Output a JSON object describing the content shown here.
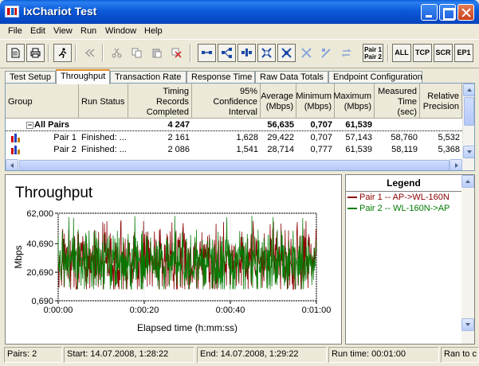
{
  "window": {
    "title": "IxChariot Test"
  },
  "menu": [
    "File",
    "Edit",
    "View",
    "Run",
    "Window",
    "Help"
  ],
  "toolbar": {
    "pair_label_1": "Pair 1",
    "pair_label_2": "Pair 2",
    "btn_all": "ALL",
    "btn_tcp": "TCP",
    "btn_scr": "SCR",
    "btn_ep1": "EP1"
  },
  "tabs": [
    {
      "label": "Test Setup"
    },
    {
      "label": "Throughput",
      "active": true
    },
    {
      "label": "Transaction Rate"
    },
    {
      "label": "Response Time"
    },
    {
      "label": "Raw Data Totals"
    },
    {
      "label": "Endpoint Configuration"
    }
  ],
  "grid": {
    "headers": {
      "group": "Group",
      "run_status": "Run Status",
      "timing": "Timing Records Completed",
      "confidence": "95% Confidence Interval",
      "average": "Average (Mbps)",
      "minimum": "Minimum (Mbps)",
      "maximum": "Maximum (Mbps)",
      "measured": "Measured Time (sec)",
      "relative": "Relative Precision"
    },
    "summary": {
      "group": "All Pairs",
      "timing": "4 247",
      "average": "56,635",
      "minimum": "0,707",
      "maximum": "61,539"
    },
    "rows": [
      {
        "group": "Pair 1",
        "status": "Finished: ...",
        "timing": "2 161",
        "confidence": "1,628",
        "average": "29,422",
        "minimum": "0,707",
        "maximum": "57,143",
        "measured": "58,760",
        "relative": "5,532"
      },
      {
        "group": "Pair 2",
        "status": "Finished: ...",
        "timing": "2 086",
        "confidence": "1,541",
        "average": "28,714",
        "minimum": "0,777",
        "maximum": "61,539",
        "measured": "58,119",
        "relative": "5,368"
      }
    ]
  },
  "chart_data": {
    "type": "line",
    "title": "Throughput",
    "xlabel": "Elapsed time (h:mm:ss)",
    "ylabel": "Mbps",
    "x_ticks": [
      "0:00:00",
      "0:00:20",
      "0:00:40",
      "0:01:00"
    ],
    "xlim_seconds": [
      0,
      60
    ],
    "y_ticks": [
      "0,690",
      "20,690",
      "40,690",
      "62,000"
    ],
    "ylim": [
      0.69,
      62.0
    ],
    "grid": true,
    "series": [
      {
        "name": "Pair 1 -- AP->WL-160N",
        "color": "#8b0000",
        "mean": 29.422,
        "min": 0.707,
        "max": 57.143,
        "x": [
          0,
          60
        ]
      },
      {
        "name": "Pair 2 -- WL-160N->AP",
        "color": "#007a00",
        "mean": 28.714,
        "min": 0.777,
        "max": 61.539,
        "x": [
          0,
          60
        ]
      }
    ]
  },
  "legend": {
    "title": "Legend"
  },
  "status": {
    "pairs": "Pairs: 2",
    "start": "Start: 14.07.2008, 1:28:22",
    "end": "End: 14.07.2008, 1:29:22",
    "runtime": "Run time: 00:01:00",
    "ran": "Ran to c"
  }
}
